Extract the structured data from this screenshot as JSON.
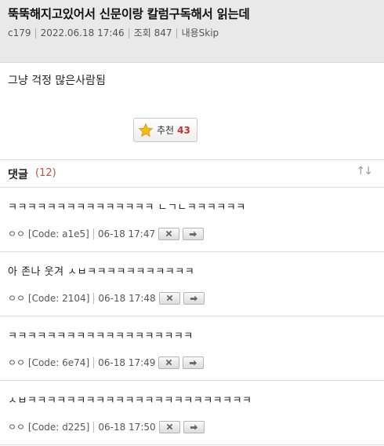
{
  "post": {
    "title": "뚝뚝해지고있어서 신문이랑 칼럼구독해서 읽는데",
    "author": "c179",
    "date": "2022.06.18 17:46",
    "views": "조회 847",
    "skip": "내용Skip",
    "body": "그냥 걱정 많은사람됨"
  },
  "recommend": {
    "label": "추천",
    "count": "43"
  },
  "comments_header": {
    "label": "댓글",
    "count": "(12)",
    "sort_icon": "↑↓"
  },
  "comments": [
    {
      "text": "ㅋㅋㅋㅋㅋㅋㅋㅋㅋㅋㅋㅋㅋㅋㅋ ㄴㄱㄴㅋㅋㅋㅋㅋㅋ",
      "author": "ㅇㅇ [Code: a1e5]",
      "time": "06-18 17:47"
    },
    {
      "text": "아 존나 웃겨 ㅅㅂㅋㅋㅋㅋㅋㅋㅋㅋㅋㅋㅋ",
      "author": "ㅇㅇ [Code: 2104]",
      "time": "06-18 17:48"
    },
    {
      "text": "ㅋㅋㅋㅋㅋㅋㅋㅋㅋㅋㅋㅋㅋㅋㅋㅋㅋㅋㅋ",
      "author": "ㅇㅇ [Code: 6e74]",
      "time": "06-18 17:49"
    },
    {
      "text": "ㅅㅂㅋㅋㅋㅋㅋㅋㅋㅋㅋㅋㅋㅋㅋㅋㅋㅋㅋㅋㅋㅋㅋㅋㅋ",
      "author": "ㅇㅇ [Code: d225]",
      "time": "06-18 17:50"
    }
  ]
}
